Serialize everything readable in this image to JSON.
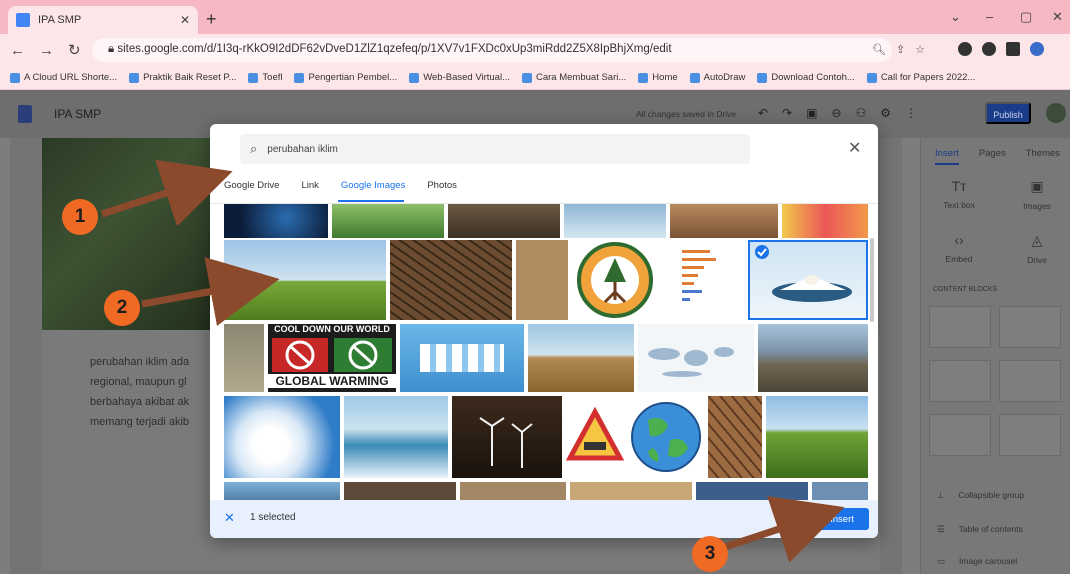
{
  "browser": {
    "tab_title": "IPA SMP",
    "url": "sites.google.com/d/1I3q-rKkO9I2dDF62vDveD1ZlZ1qzefeq/p/1XV7v1FXDc0xUp3miRdd2Z5X8IpBhjXmg/edit",
    "bookmarks": [
      "A Cloud URL Shorte...",
      "Praktik Baik Reset P...",
      "Toefl",
      "Pengertian Pembel...",
      "Web-Based Virtual...",
      "Cara Membuat Sari...",
      "Home",
      "AutoDraw",
      "Download Contoh...",
      "Call for Papers 2022..."
    ]
  },
  "editor": {
    "title": "IPA SMP",
    "saved_status": "All changes saved in Drive",
    "publish_label": "Publish",
    "body_lines": [
      "perubahan iklim ada",
      "regional, maupun gl",
      "berbahaya akibat ak",
      "memang terjadi akib"
    ],
    "right_tabs": [
      "Insert",
      "Pages",
      "Themes"
    ],
    "tools": [
      "Text box",
      "Images",
      "Embed",
      "Drive"
    ],
    "content_blocks_label": "CONTENT BLOCKS",
    "list_items": [
      "Collapsible group",
      "Table of contents",
      "Image carousel"
    ]
  },
  "dialog": {
    "search_value": "perubahan iklim",
    "tabs": [
      "Google Drive",
      "Link",
      "Google Images",
      "Photos"
    ],
    "active_tab": "Google Images",
    "tile_texts": {
      "cool_down": "COOL DOWN OUR WORLD",
      "global_warming": "GLOBAL WARMING"
    },
    "selected_label": "1 selected",
    "insert_label": "Insert"
  },
  "callouts": [
    "1",
    "2",
    "3"
  ],
  "colors": {
    "accent_blue": "#1a73e8",
    "callout_orange": "#f06a24",
    "arrow_brown": "#8b4a2b"
  }
}
